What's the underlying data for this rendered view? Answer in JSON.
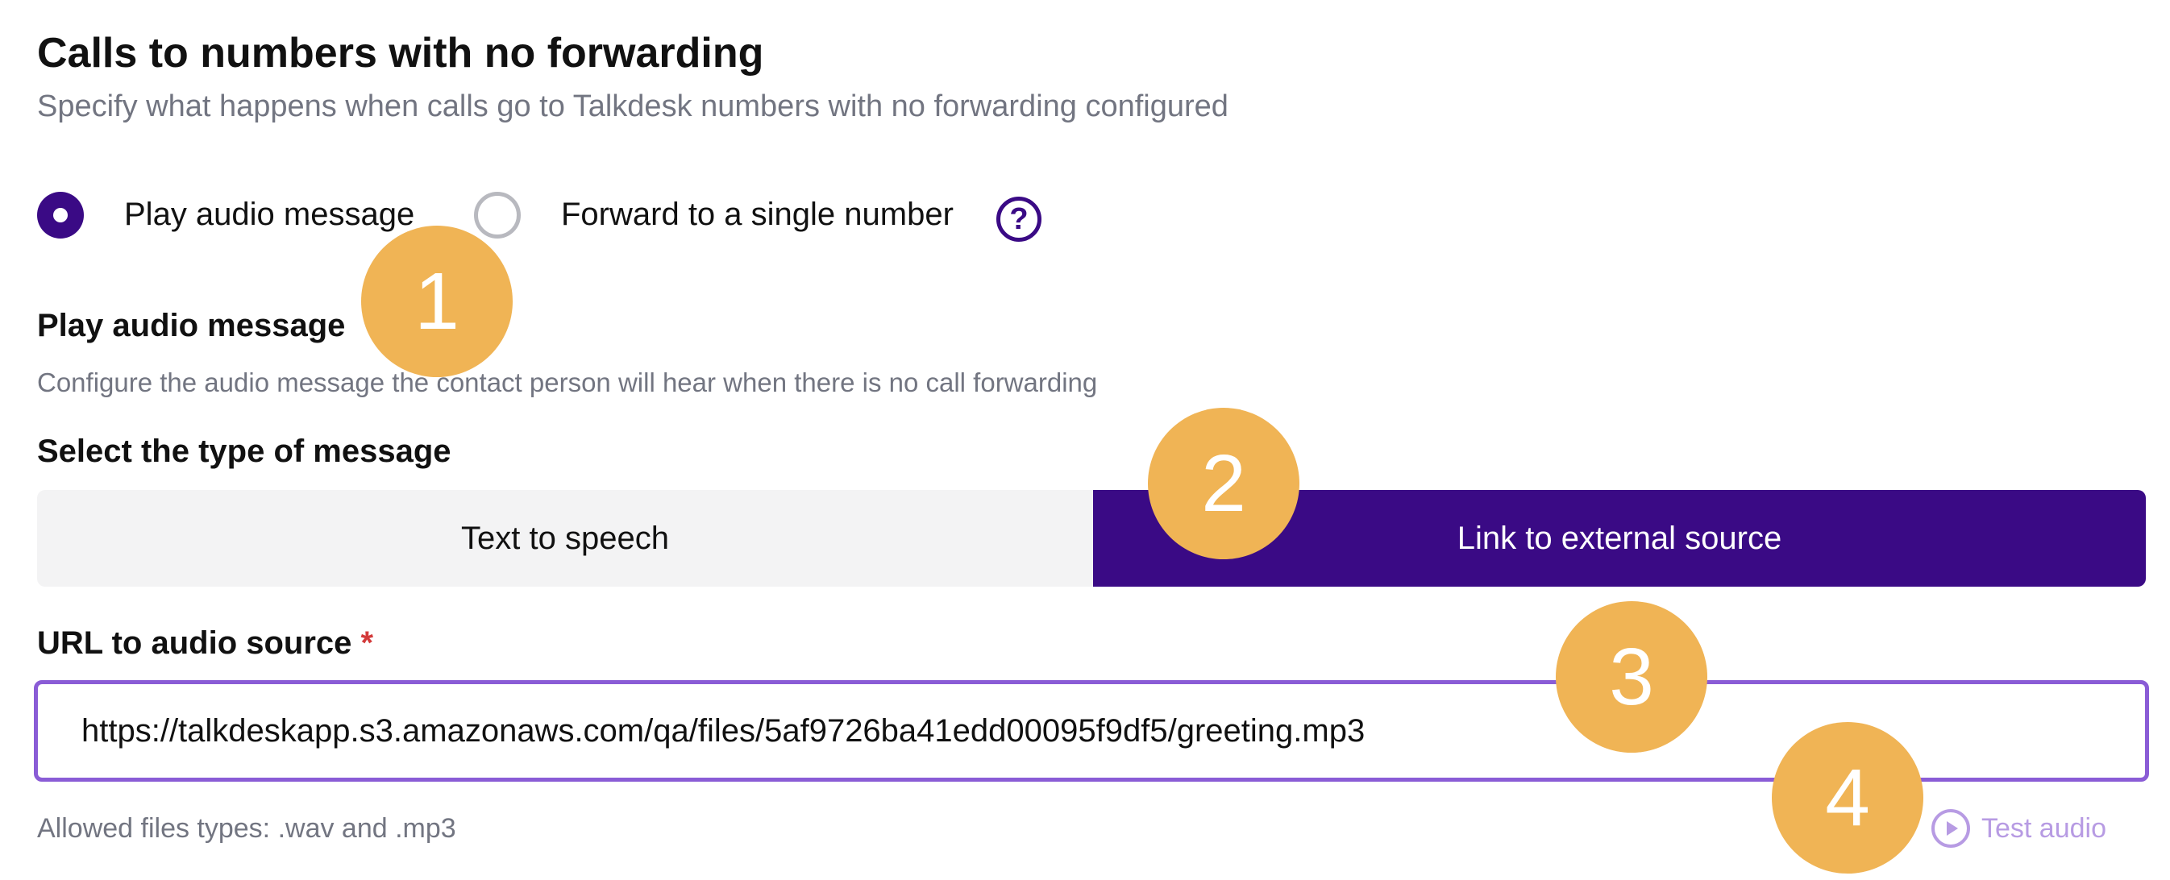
{
  "header": {
    "title": "Calls to numbers with no forwarding",
    "subtitle": "Specify what happens when calls go to Talkdesk numbers with no forwarding configured"
  },
  "routing_options": {
    "selected": "Play audio message",
    "option1_label": "Play audio message",
    "option2_label": "Forward to a single number",
    "help_glyph": "?"
  },
  "play_audio": {
    "title": "Play audio message",
    "description": "Configure the audio message the contact person will hear when there is no call forwarding"
  },
  "message_type": {
    "label": "Select the type of message",
    "selected": "Link to external source",
    "options": [
      "Text to speech",
      "Link to external source"
    ]
  },
  "url_field": {
    "label": "URL to audio source",
    "required_marker": "*",
    "value": "https://talkdeskapp.s3.amazonaws.com/qa/files/5af9726ba41edd00095f9df5/greeting.mp3",
    "helper": "Allowed files types: .wav and .mp3"
  },
  "test_audio": {
    "label": "Test audio",
    "icon": "play-circle-icon"
  },
  "callouts": [
    "1",
    "2",
    "3",
    "4"
  ],
  "colors": {
    "primary": "#3a0a85",
    "focus_border": "#8a5cd6",
    "muted_text": "#727581",
    "callout": "#f0b455",
    "link_disabled": "#b79be3",
    "required": "#d33a3a"
  }
}
